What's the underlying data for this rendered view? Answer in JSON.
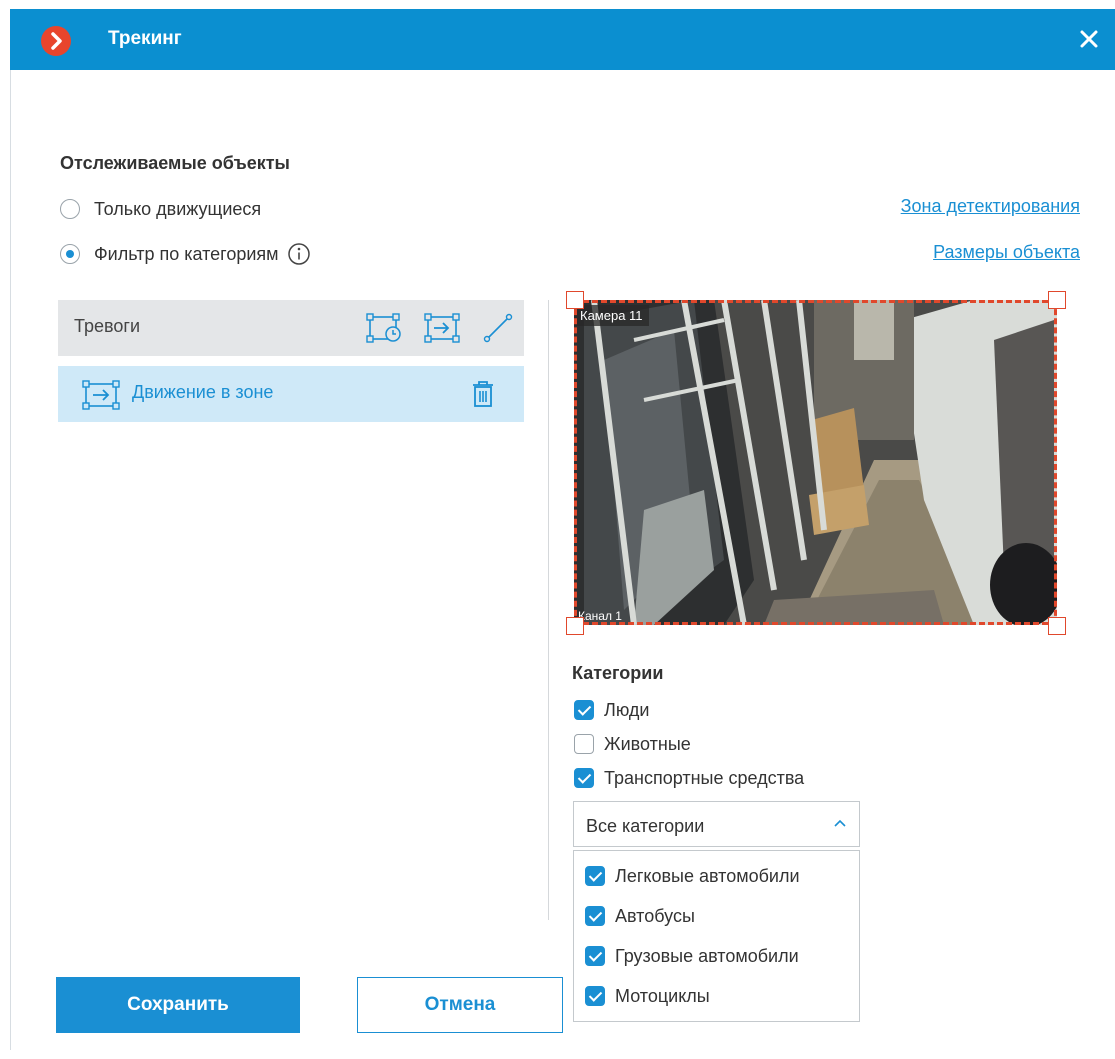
{
  "window": {
    "title": "Трекинг",
    "accent_color": "#0b8fd0",
    "logo_color": "#e8452c"
  },
  "tracked_objects": {
    "title": "Отслеживаемые объекты",
    "options": [
      {
        "label": "Только движущиеся",
        "selected": false
      },
      {
        "label": "Фильтр по категориям",
        "selected": true
      }
    ]
  },
  "links": {
    "detection_zone": "Зона детектирования",
    "object_sizes": "Размеры объекта"
  },
  "alarms": {
    "title": "Тревоги",
    "items": [
      {
        "label": "Движение в зоне"
      }
    ]
  },
  "camera": {
    "name": "Камера 11",
    "channel": "Канал 1"
  },
  "categories": {
    "title": "Категории",
    "items": [
      {
        "label": "Люди",
        "checked": true
      },
      {
        "label": "Животные",
        "checked": false
      },
      {
        "label": "Транспортные средства",
        "checked": true
      }
    ],
    "vehicle_select": {
      "value": "Все категории",
      "options": [
        {
          "label": "Легковые автомобили",
          "checked": true
        },
        {
          "label": "Автобусы",
          "checked": true
        },
        {
          "label": "Грузовые автомобили",
          "checked": true
        },
        {
          "label": "Мотоциклы",
          "checked": true
        }
      ]
    }
  },
  "buttons": {
    "save": "Сохранить",
    "cancel": "Отмена"
  }
}
